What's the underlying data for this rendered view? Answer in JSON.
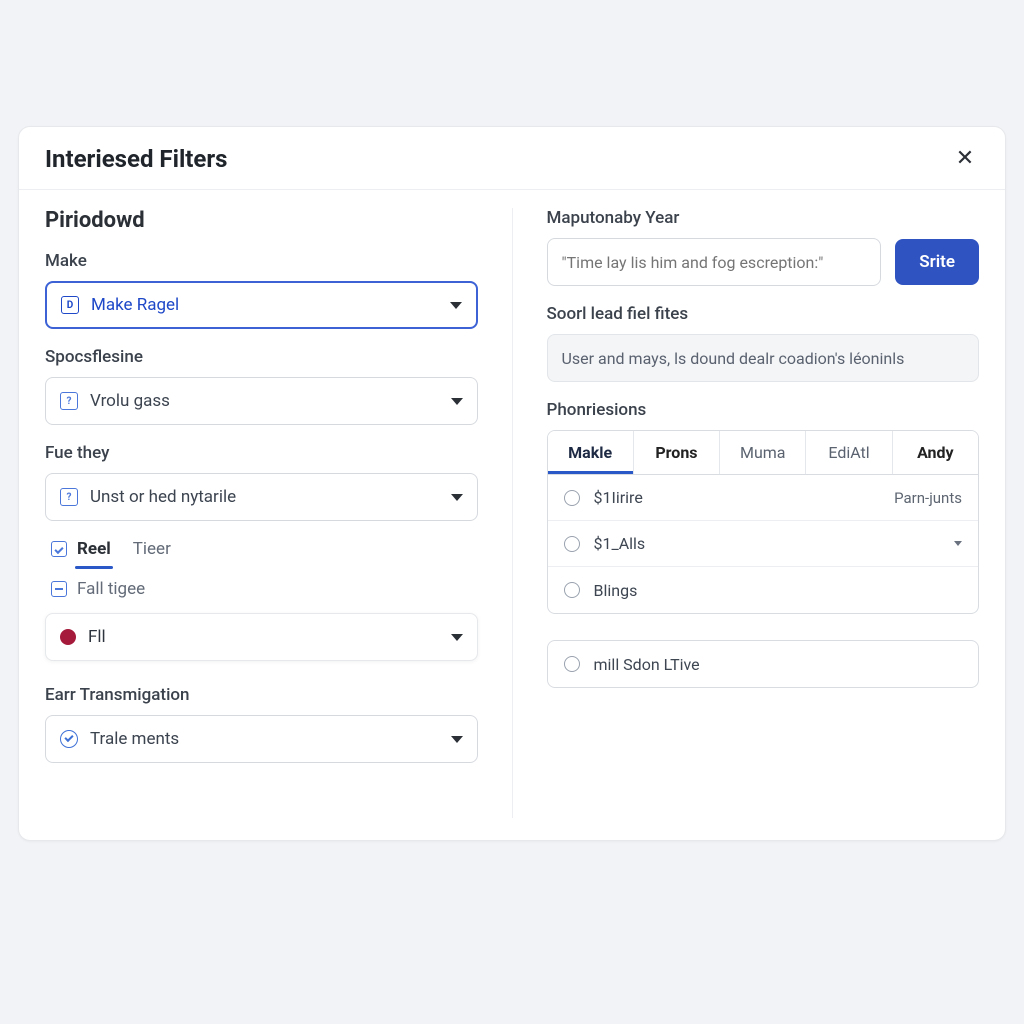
{
  "modal": {
    "title": "Interiesed Filters"
  },
  "left": {
    "section_title": "Piriodowd",
    "make": {
      "label": "Make",
      "value": "Make Ragel",
      "icon_text": "D"
    },
    "spocs": {
      "label": "Spocsflesine",
      "value": "Vrolu gass",
      "icon_text": "?"
    },
    "fue": {
      "label": "Fue they",
      "value": "Unst or hed nytarile",
      "icon_text": "?"
    },
    "chips": {
      "reel": "Reel",
      "tieer": "Tieer",
      "fall": "Fall tigee"
    },
    "fil": {
      "label": "Fll"
    },
    "earr": {
      "label": "Earr Transmigation",
      "value": "Trale ments"
    }
  },
  "right": {
    "year": {
      "label": "Maputonaby Year",
      "placeholder": "\"Time lay lis him and fog escreption:\"",
      "button": "Srite"
    },
    "soorl": {
      "label": "Soorl lead fiel fites",
      "value": "User and mays, ls dound dealr coadion's léoninls"
    },
    "phon": {
      "label": "Phonriesions",
      "tabs": [
        "Makle",
        "Prons",
        "Muma",
        "EdiAtl",
        "Andy"
      ],
      "rows": [
        {
          "text": "$1Iirire",
          "extra": "Parn-junts"
        },
        {
          "text": "$1_Alls",
          "caret": true
        },
        {
          "text": "Blings"
        }
      ],
      "standalone": "mill Sdon LTive"
    }
  }
}
